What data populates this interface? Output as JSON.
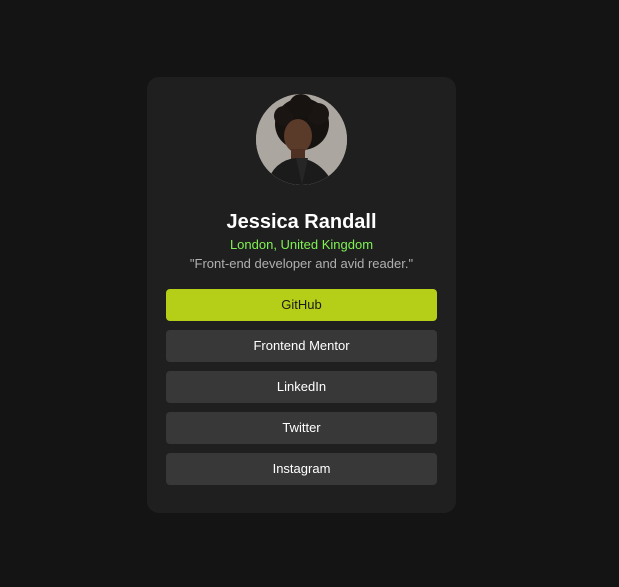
{
  "profile": {
    "name": "Jessica Randall",
    "location": "London, United Kingdom",
    "bio": "\"Front-end developer and avid reader.\"",
    "avatar_icon": "avatar-photo"
  },
  "links": [
    {
      "label": "GitHub",
      "active": true
    },
    {
      "label": "Frontend Mentor",
      "active": false
    },
    {
      "label": "LinkedIn",
      "active": false
    },
    {
      "label": "Twitter",
      "active": false
    },
    {
      "label": "Instagram",
      "active": false
    }
  ],
  "colors": {
    "background": "#141414",
    "card": "#1f1f1f",
    "accent": "#b5cf18",
    "location": "#7ff251",
    "button": "#383838"
  }
}
